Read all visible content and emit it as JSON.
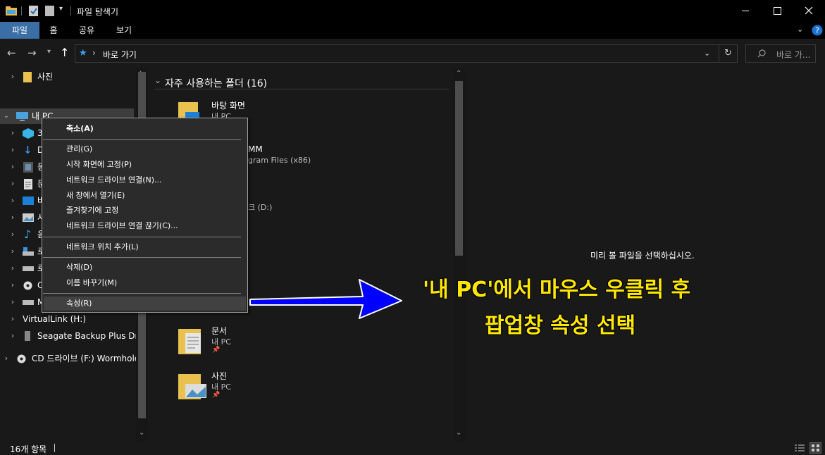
{
  "window": {
    "title": "파일 탐색기",
    "controls": {
      "minimize": "minimize-icon",
      "maximize": "maximize-icon",
      "close": "close-icon"
    }
  },
  "ribbon": {
    "tabs": [
      "파일",
      "홈",
      "공유",
      "보기"
    ],
    "active_tab_color": "#3a6ea5"
  },
  "address": {
    "path": "바로 가기",
    "search_placeholder": "바로 가..."
  },
  "nav": {
    "items": [
      {
        "label": "사진",
        "icon": "folder-icon"
      },
      {
        "label": "내 PC",
        "icon": "pc-icon",
        "expanded": true
      },
      {
        "label": "3",
        "icon": "3d-objects-icon"
      },
      {
        "label": "D",
        "icon": "download-icon"
      },
      {
        "label": "동",
        "icon": "video-icon"
      },
      {
        "label": "문",
        "icon": "document-icon"
      },
      {
        "label": "바",
        "icon": "desktop-icon"
      },
      {
        "label": "사",
        "icon": "picture-icon"
      },
      {
        "label": "음",
        "icon": "music-icon"
      },
      {
        "label": "로",
        "icon": "disk-icon"
      },
      {
        "label": "로",
        "icon": "drive-icon"
      },
      {
        "label": "C",
        "icon": "cd-icon"
      },
      {
        "label": "M",
        "icon": "drive-icon"
      },
      {
        "label": "VirtualLink (H:)",
        "icon": "drive-icon"
      },
      {
        "label": "Seagate Backup Plus Drive",
        "icon": "usb-icon"
      },
      {
        "label": "CD 드라이브 (F:) Wormhole",
        "icon": "cd-icon"
      }
    ]
  },
  "content": {
    "section_title": "자주 사용하는 폴더 (16)",
    "tiles": [
      {
        "title": "바탕 화면",
        "sub": "내 PC"
      },
      {
        "title": "MM",
        "sub": "gram Files (x86)"
      },
      {
        "title": "",
        "sub": "크 (D:)"
      },
      {
        "title": "문서",
        "sub": "내 PC"
      },
      {
        "title": "사진",
        "sub": "내 PC"
      }
    ]
  },
  "preview": {
    "message": "미리 볼 파일을 선택하십시오."
  },
  "context_menu": {
    "items": [
      {
        "label": "축소(A)",
        "bold": true
      },
      {
        "label": "관리(G)"
      },
      {
        "label": "시작 화면에 고정(P)"
      },
      {
        "label": "네트워크 드라이브 연결(N)..."
      },
      {
        "label": "새 창에서 열기(E)"
      },
      {
        "label": "즐겨찾기에 고정"
      },
      {
        "label": "네트워크 드라이브 연결 끊기(C)..."
      },
      {
        "label": "네트워크 위치 추가(L)"
      },
      {
        "label": "삭제(D)"
      },
      {
        "label": "이름 바꾸기(M)"
      },
      {
        "label": "속성(R)",
        "highlighted": true
      }
    ]
  },
  "annotation": {
    "line1": "'내 PC'에서 마우스 우클릭 후",
    "line2": "팝업창 속성 선택",
    "color": "#ffe800",
    "arrow_color": "#0000ff"
  },
  "status": {
    "count": "16개 항목"
  }
}
